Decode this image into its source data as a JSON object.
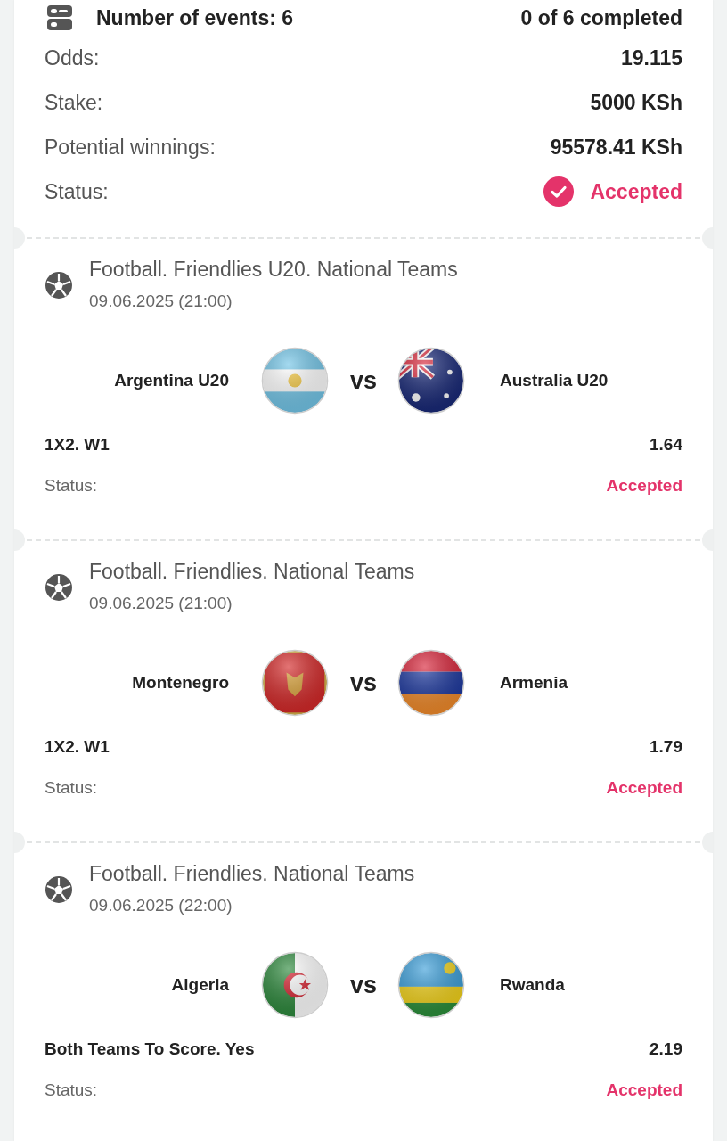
{
  "summary": {
    "events_label": "Number of events: 6",
    "progress": "0 of 6 completed",
    "rows": [
      {
        "label": "Odds:",
        "value": "19.115",
        "kind": "text"
      },
      {
        "label": "Stake:",
        "value": "5000 KSh",
        "kind": "text"
      },
      {
        "label": "Potential winnings:",
        "value": "95578.41 KSh",
        "kind": "text"
      },
      {
        "label": "Status:",
        "value": "Accepted",
        "kind": "status"
      }
    ]
  },
  "events": [
    {
      "league": "Football. Friendlies U20. National Teams",
      "date": "09.06.2025 (21:00)",
      "home": {
        "name": "Argentina U20",
        "kind": "argentina"
      },
      "vs": "vs",
      "away": {
        "name": "Australia U20",
        "kind": "australia"
      },
      "market": "1X2. W1",
      "odds": "1.64",
      "status_label": "Status:",
      "status": "Accepted"
    },
    {
      "league": "Football. Friendlies. National Teams",
      "date": "09.06.2025 (21:00)",
      "home": {
        "name": "Montenegro",
        "kind": "montenegro"
      },
      "vs": "vs",
      "away": {
        "name": "Armenia",
        "kind": "armenia"
      },
      "market": "1X2. W1",
      "odds": "1.79",
      "status_label": "Status:",
      "status": "Accepted"
    },
    {
      "league": "Football. Friendlies. National Teams",
      "date": "09.06.2025 (22:00)",
      "home": {
        "name": "Algeria",
        "kind": "algeria"
      },
      "vs": "vs",
      "away": {
        "name": "Rwanda",
        "kind": "rwanda"
      },
      "market": "Both Teams To Score. Yes",
      "odds": "2.19",
      "status_label": "Status:",
      "status": "Accepted"
    }
  ]
}
